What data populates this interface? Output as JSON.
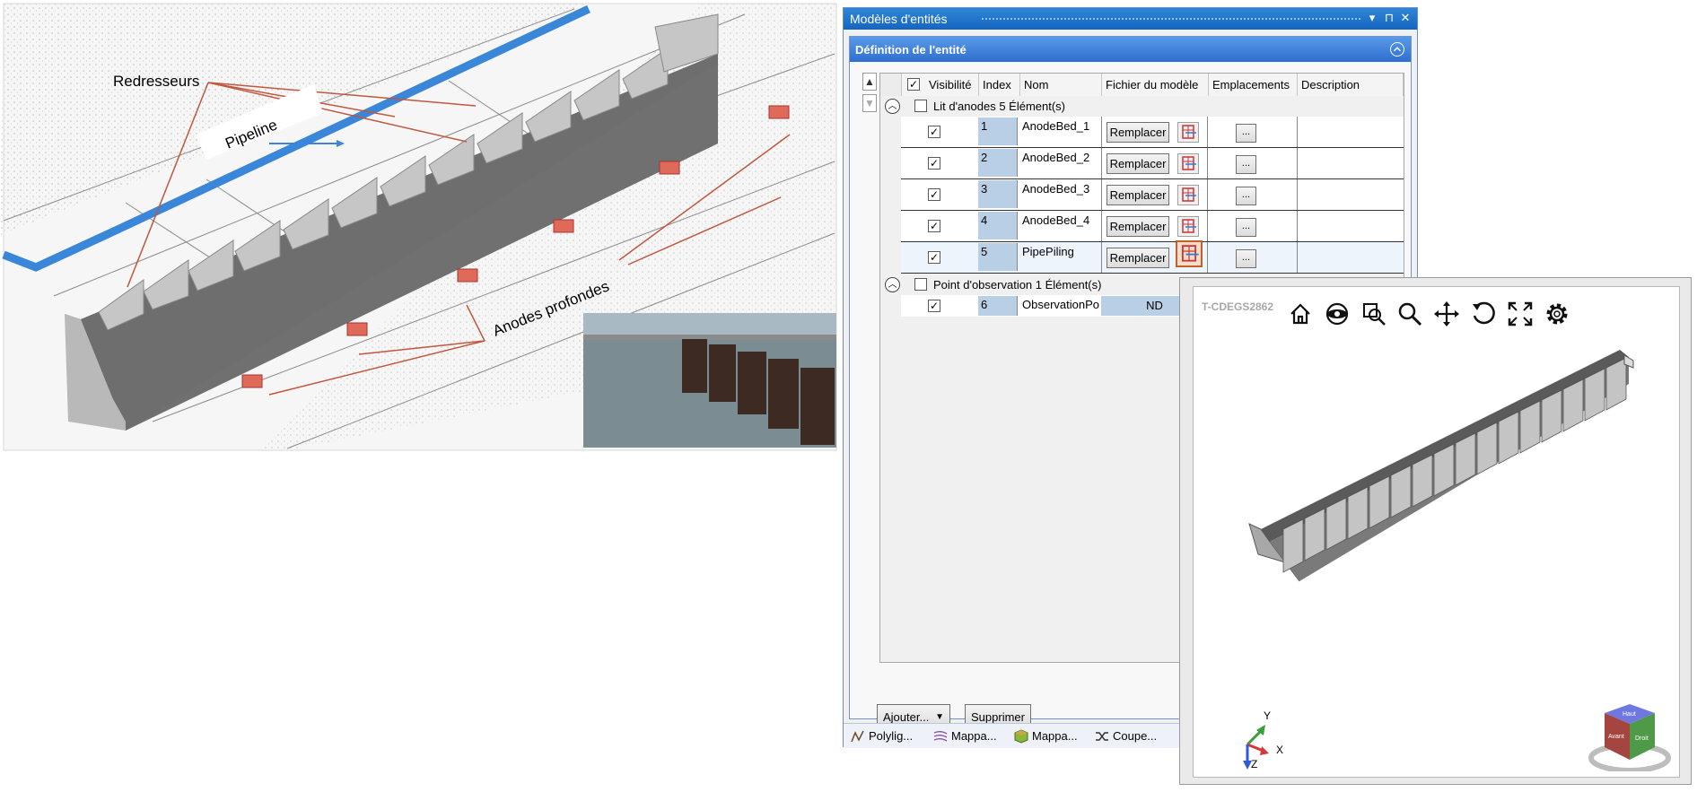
{
  "scene": {
    "annotations": {
      "rectifiers": "Redresseurs",
      "pipeline": "Pipeline",
      "deep_anodes": "Anodes profondes"
    }
  },
  "panel": {
    "title": "Modèles d'entités",
    "section_title": "Définition de l'entité",
    "columns": [
      "Visibilité",
      "Index",
      "Nom",
      "Fichier du modèle",
      "Emplacements",
      "Description"
    ],
    "groups": [
      {
        "label": "Lit d'anodes 5 Élément(s)",
        "rows": [
          {
            "index": "1",
            "name": "AnodeBed_1",
            "model": "Remplacer",
            "locations": "..."
          },
          {
            "index": "2",
            "name": "AnodeBed_2",
            "model": "Remplacer",
            "locations": "..."
          },
          {
            "index": "3",
            "name": "AnodeBed_3",
            "model": "Remplacer",
            "locations": "..."
          },
          {
            "index": "4",
            "name": "AnodeBed_4",
            "model": "Remplacer",
            "locations": "..."
          },
          {
            "index": "5",
            "name": "PipePiling",
            "model": "Remplacer",
            "locations": "..."
          }
        ]
      },
      {
        "label": "Point d'observation 1 Élément(s)",
        "rows": [
          {
            "index": "6",
            "name": "ObservationPo",
            "model": "ND"
          }
        ]
      }
    ],
    "buttons": {
      "add": "Ajouter...",
      "delete": "Supprimer"
    },
    "tabs": [
      "Polylig...",
      "Mappa...",
      "Mappa...",
      "Coupe..."
    ]
  },
  "viewer": {
    "title": "T-CDEGS2862",
    "axes": {
      "x": "X",
      "y": "Y",
      "z": "Z"
    },
    "nav_cube": {
      "top": "Haut",
      "front": "Avant",
      "right": "Droit"
    }
  },
  "colors": {
    "panel_title": "#1565c0",
    "section_header": "#3d7fdc",
    "highlight": "#c0602d"
  }
}
